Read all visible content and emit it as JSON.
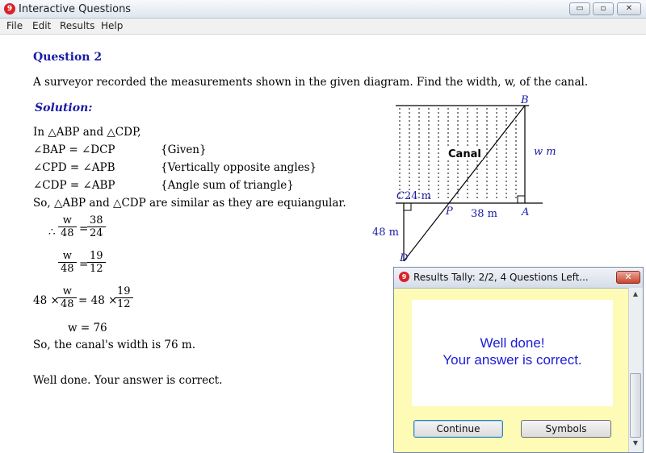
{
  "window": {
    "title": "Interactive Questions",
    "app_icon_glyph": "9",
    "minimize_glyph": "▭",
    "maximize_glyph": "▫",
    "close_glyph": "✕"
  },
  "menu": [
    "File",
    "Edit",
    "Results",
    "Help"
  ],
  "question": {
    "title": "Question 2",
    "text": "A surveyor recorded the measurements shown in the given diagram.  Find the width, w, of the canal."
  },
  "solution": {
    "title": "Solution:",
    "intro": "In △ABP and △CDP,",
    "reasons": [
      {
        "stmt": "∠BAP = ∠DCP",
        "reason": "{Given}"
      },
      {
        "stmt": "∠CPD = ∠APB",
        "reason": "{Vertically opposite angles}"
      },
      {
        "stmt": "∠CDP = ∠ABP",
        "reason": "{Angle sum of triangle}"
      }
    ],
    "similar": "So, △ABP and △CDP are similar as they are equiangular.",
    "therefore": "∴",
    "frac1": {
      "ln": "w",
      "ld": "48",
      "rn": "38",
      "rd": "24"
    },
    "frac2": {
      "ln": "w",
      "ld": "48",
      "rn": "19",
      "rd": "12"
    },
    "frac3": {
      "pre": "48 ×",
      "ln": "w",
      "ld": "48",
      "mid": "= 48 ×",
      "rn": "19",
      "rd": "12"
    },
    "eq_sign": "=",
    "result": "w = 76",
    "conclusion": "So, the canal's width is 76 m.",
    "feedback": "Well done.  Your answer is correct."
  },
  "diagram": {
    "B": "B",
    "C": "C",
    "P": "P",
    "A": "A",
    "D": "D",
    "canal": "Canal",
    "w": "w m",
    "cp": "24 m",
    "pa": "38 m",
    "cd": "48 m"
  },
  "dialog": {
    "title": "Results Tally:  2/2, 4 Questions Left...",
    "icon_glyph": "9",
    "close_glyph": "✕",
    "message1": "Well done!",
    "message2": "Your answer is correct.",
    "continue": "Continue",
    "symbols": "Symbols",
    "scroll_up": "▲",
    "scroll_down": "▼"
  }
}
